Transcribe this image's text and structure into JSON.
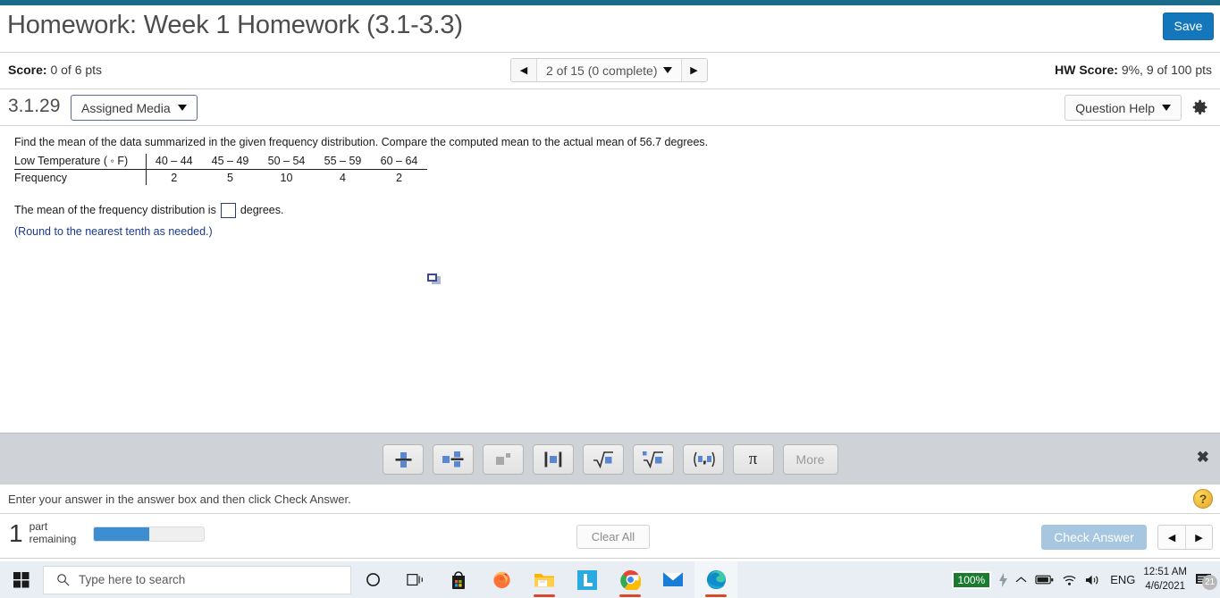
{
  "theme": {
    "accent": "#1b6b8a",
    "primary_button": "#1477bc",
    "progress": "#3d8ed0",
    "link": "#1a3a8f"
  },
  "header": {
    "title": "Homework: Week 1 Homework (3.1-3.3)",
    "save_label": "Save"
  },
  "score_bar": {
    "score_label": "Score:",
    "score_value": "0 of 6 pts",
    "hw_score_label": "HW Score:",
    "hw_score_value": "9%, 9 of 100 pts",
    "pager": "2 of 15 (0 complete)"
  },
  "question_bar": {
    "number": "3.1.29",
    "assigned_media": "Assigned Media",
    "question_help": "Question Help",
    "gear": "gear-icon"
  },
  "problem": {
    "prompt": "Find the mean of the data summarized in the given frequency distribution. Compare the computed mean to the actual mean of 56.7 degrees.",
    "table": {
      "row_labels": [
        "Low Temperature ( ◦ F)",
        "Frequency"
      ],
      "bins": [
        "40 – 44",
        "45 – 49",
        "50 – 54",
        "55 – 59",
        "60 – 64"
      ],
      "frequencies": [
        "2",
        "5",
        "10",
        "4",
        "2"
      ]
    },
    "answer_prefix": "The mean of the frequency distribution is",
    "answer_value": "",
    "answer_suffix": "degrees.",
    "rounding_note": "(Round to the nearest tenth as needed.)"
  },
  "math_palette": {
    "buttons": [
      {
        "name": "fraction-icon",
        "label": ""
      },
      {
        "name": "mixed-number-icon",
        "label": ""
      },
      {
        "name": "exponent-icon",
        "label": ""
      },
      {
        "name": "absolute-value-icon",
        "label": ""
      },
      {
        "name": "square-root-icon",
        "label": ""
      },
      {
        "name": "nth-root-icon",
        "label": ""
      },
      {
        "name": "interval-notation-icon",
        "label": ""
      },
      {
        "name": "pi-icon",
        "label": "π"
      },
      {
        "name": "more-button",
        "label": "More"
      }
    ],
    "close_label": "✖"
  },
  "instruction": {
    "text": "Enter your answer in the answer box and then click Check Answer.",
    "help_label": "?"
  },
  "footer": {
    "parts_count": "1",
    "parts_line1": "part",
    "parts_line2": "remaining",
    "progress_percent": 50,
    "clear_all": "Clear All",
    "check_answer": "Check Answer"
  },
  "taskbar": {
    "search_placeholder": "Type here to search",
    "apps": [
      {
        "name": "task-view-icon"
      },
      {
        "name": "microsoft-store-icon"
      },
      {
        "name": "firefox-icon"
      },
      {
        "name": "file-explorer-icon"
      },
      {
        "name": "app-l-icon"
      },
      {
        "name": "chrome-icon"
      },
      {
        "name": "mail-icon"
      },
      {
        "name": "edge-icon"
      }
    ],
    "tray": {
      "battery_percent": "100%",
      "language": "ENG",
      "time": "12:51 AM",
      "date": "4/6/2021",
      "notification_count": "21"
    }
  }
}
